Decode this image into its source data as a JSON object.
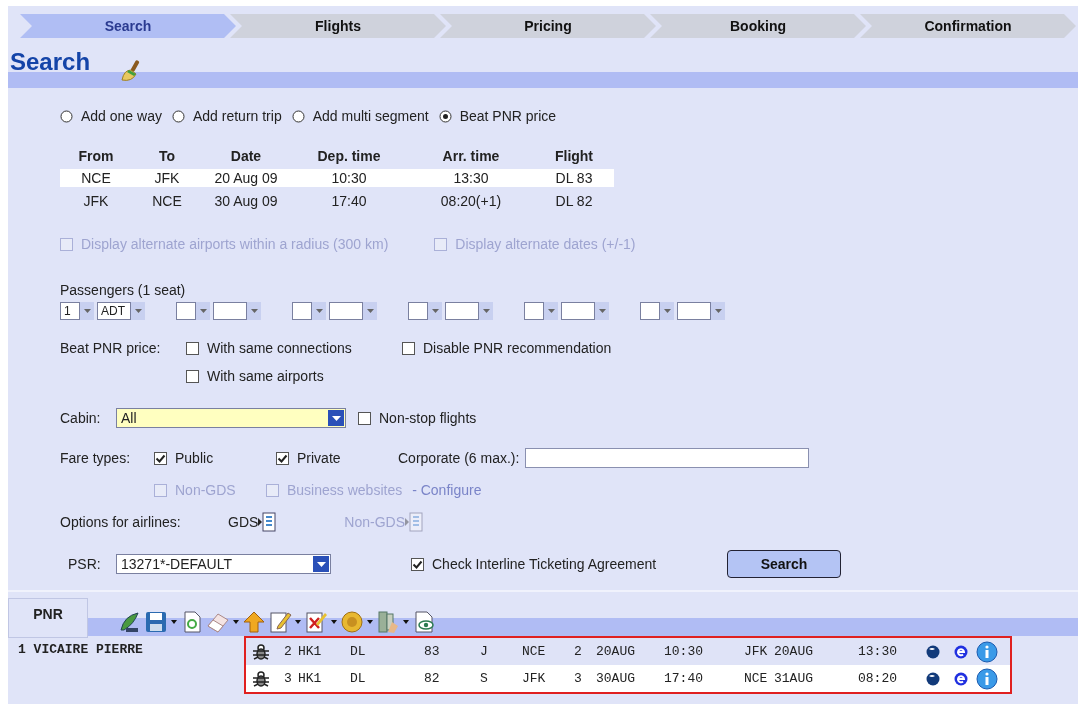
{
  "steps": [
    {
      "label": "Search",
      "selected": true
    },
    {
      "label": "Flights",
      "selected": false
    },
    {
      "label": "Pricing",
      "selected": false
    },
    {
      "label": "Booking",
      "selected": false
    },
    {
      "label": "Confirmation",
      "selected": false
    }
  ],
  "title": "Search",
  "trip_options": [
    {
      "label": "Add one way",
      "selected": false
    },
    {
      "label": "Add return trip",
      "selected": false
    },
    {
      "label": "Add multi segment",
      "selected": false
    },
    {
      "label": "Beat PNR price",
      "selected": true
    }
  ],
  "segments": {
    "columns": [
      "From",
      "To",
      "Date",
      "Dep. time",
      "Arr. time",
      "Flight"
    ],
    "rows": [
      {
        "cells": [
          "NCE",
          "JFK",
          "20 Aug 09",
          "10:30",
          "13:30",
          "DL 83"
        ],
        "selected": true
      },
      {
        "cells": [
          "JFK",
          "NCE",
          "30 Aug 09",
          "17:40",
          "08:20(+1)",
          "DL 82"
        ],
        "selected": false
      }
    ]
  },
  "alternate_options": [
    {
      "label": "Display alternate airports within a radius (300 km)",
      "checked": false,
      "disabled": true
    },
    {
      "label": "Display alternate dates (+/-1)",
      "checked": false,
      "disabled": true
    }
  ],
  "passengers": {
    "label": "Passengers  (1 seat)",
    "groups": [
      {
        "kind": "filled",
        "number": "1",
        "type": "ADT"
      },
      {
        "kind": "blank"
      },
      {
        "kind": "blank"
      },
      {
        "kind": "blank"
      },
      {
        "kind": "blank"
      },
      {
        "kind": "blank"
      }
    ]
  },
  "beat_pnr": {
    "label": "Beat PNR price:",
    "options": [
      {
        "label": "With same connections",
        "checked": false
      },
      {
        "label": "Disable PNR recommendation",
        "checked": false
      },
      {
        "label": "With same airports",
        "checked": false
      }
    ]
  },
  "cabin": {
    "label": "Cabin:",
    "value": "All"
  },
  "non_stop": {
    "label": "Non-stop flights",
    "checked": false
  },
  "fare_types": {
    "label": "Fare types:",
    "options": [
      {
        "label": "Public",
        "checked": true,
        "disabled": false
      },
      {
        "label": "Private",
        "checked": true,
        "disabled": false
      }
    ],
    "corporate_label": "Corporate (6 max.):",
    "extra_options": [
      {
        "label": "Non-GDS",
        "checked": false,
        "disabled": true
      },
      {
        "label": "Business websites",
        "checked": false,
        "disabled": true
      }
    ],
    "configure": "- Configure"
  },
  "airline_options": {
    "label": "Options for airlines:",
    "buttons": [
      {
        "label": "GDS",
        "disabled": false
      },
      {
        "label": "Non-GDS",
        "disabled": true
      }
    ]
  },
  "psr": {
    "label": "PSR:",
    "value": "13271*-DEFAULT"
  },
  "interline": {
    "label": "Check Interline Ticketing Agreement",
    "checked": true
  },
  "search_button": "Search",
  "pnr": {
    "tab": "PNR",
    "passenger": "1 VICAIRE PIERRE",
    "segments": [
      {
        "cells": [
          "2",
          "HK1",
          "DL",
          "83",
          "J",
          "NCE",
          "2",
          "20AUG",
          "10:30",
          "JFK",
          "20AUG",
          "13:30"
        ]
      },
      {
        "cells": [
          "3",
          "HK1",
          "DL",
          "82",
          "S",
          "JFK",
          "3",
          "30AUG",
          "17:40",
          "NCE",
          "31AUG",
          "08:20"
        ]
      }
    ]
  }
}
